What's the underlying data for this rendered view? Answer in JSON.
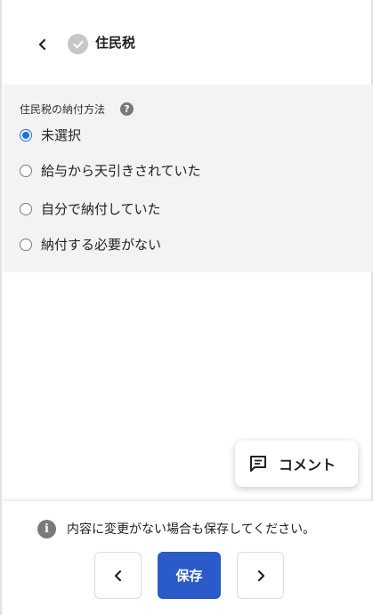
{
  "header": {
    "title": "住民税",
    "back_icon": "chevron-left-icon",
    "status_icon": "check-circle-icon"
  },
  "form": {
    "label": "住民税の納付方法",
    "help_icon": "question-circle-icon",
    "options": [
      {
        "label": "未選択",
        "checked": true
      },
      {
        "label": "給与から天引きされていた",
        "checked": false
      },
      {
        "label": "自分で納付していた",
        "checked": false
      },
      {
        "label": "納付する必要がない",
        "checked": false
      }
    ]
  },
  "comment": {
    "label": "コメント",
    "icon": "comment-icon"
  },
  "footer": {
    "notice": "内容に変更がない場合も保存してください。",
    "info_icon": "info-icon",
    "save_label": "保存",
    "prev_icon": "chevron-left-icon",
    "next_icon": "chevron-right-icon"
  },
  "colors": {
    "accent": "#2a5bc9",
    "radio_checked": "#1e6fd9",
    "section_bg": "#f4f2f2",
    "icon_gray": "#7a7a7a"
  }
}
